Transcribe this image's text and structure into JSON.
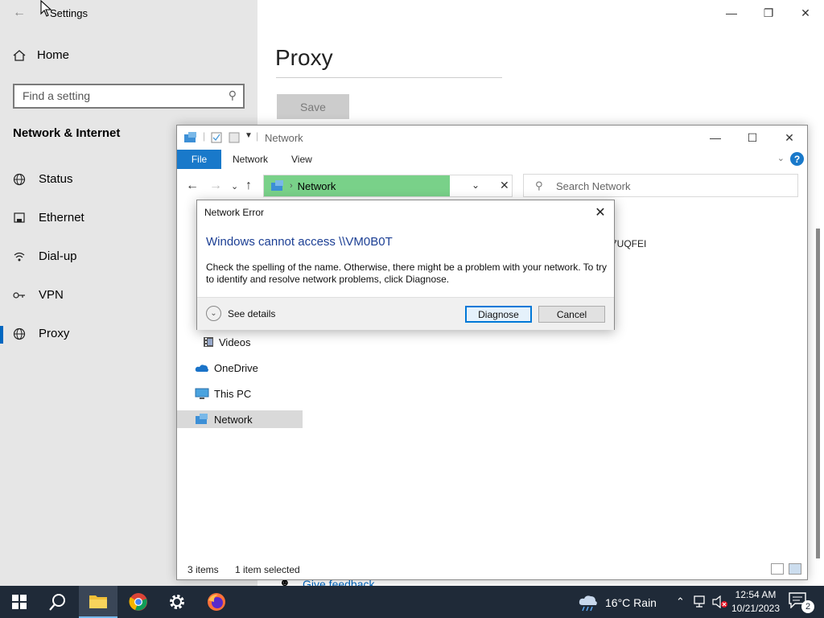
{
  "settings": {
    "title": "Settings",
    "home_label": "Home",
    "search_placeholder": "Find a setting",
    "section_title": "Network & Internet",
    "nav": [
      {
        "label": "Status",
        "icon": "globe-icon"
      },
      {
        "label": "Ethernet",
        "icon": "ethernet-icon"
      },
      {
        "label": "Dial-up",
        "icon": "dialup-icon"
      },
      {
        "label": "VPN",
        "icon": "vpn-icon"
      },
      {
        "label": "Proxy",
        "icon": "globe-icon",
        "selected": true
      }
    ],
    "page_title": "Proxy",
    "save_label": "Save",
    "feedback_label": "Give feedback"
  },
  "explorer": {
    "title": "Network",
    "ribbon_tabs": {
      "file": "File",
      "network": "Network",
      "view": "View"
    },
    "address": "Network",
    "search_placeholder": "Search Network",
    "tree": {
      "videos": "Videos",
      "onedrive": "OneDrive",
      "thispc": "This PC",
      "network": "Network"
    },
    "content_item_partial": "7UQFEI",
    "status": {
      "items": "3 items",
      "selected": "1 item selected"
    }
  },
  "dialog": {
    "title": "Network Error",
    "heading": "Windows cannot access \\\\VM0B0T",
    "message": "Check the spelling of the name. Otherwise, there might be a problem with your network. To try to identify and resolve network problems, click Diagnose.",
    "see_details": "See details",
    "diagnose_label": "Diagnose",
    "cancel_label": "Cancel"
  },
  "taskbar": {
    "weather": "16°C  Rain",
    "time": "12:54 AM",
    "date": "10/21/2023",
    "notification_count": "2"
  },
  "colors": {
    "accent": "#0067c0",
    "address_bar": "#79d189",
    "file_tab": "#1979ca",
    "taskbar": "#1f2a38"
  }
}
